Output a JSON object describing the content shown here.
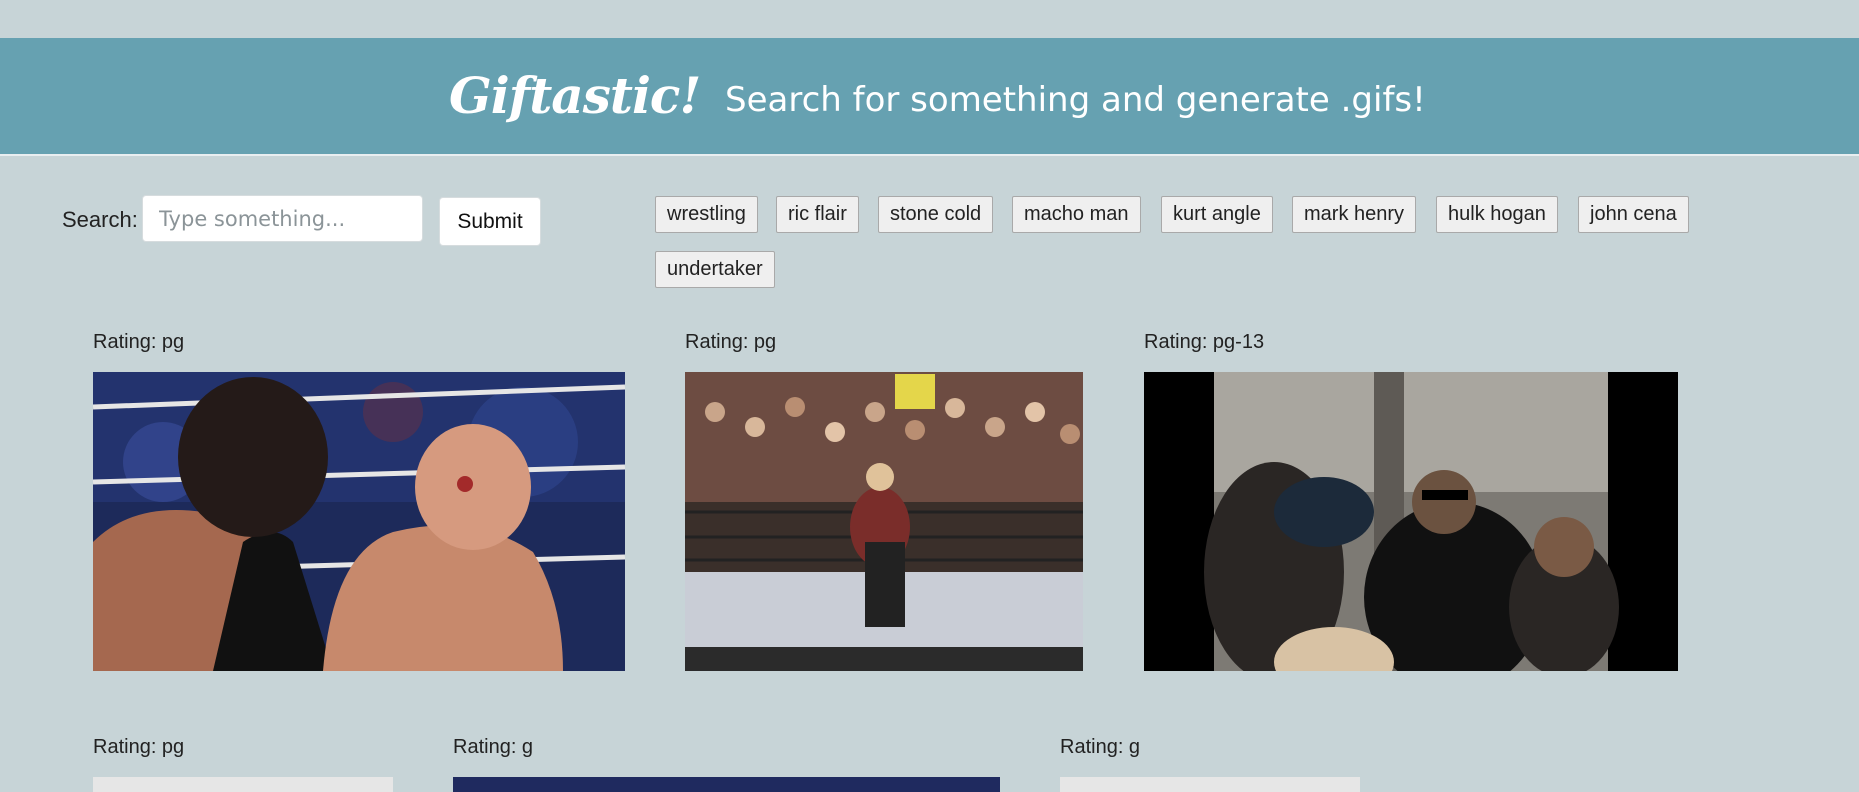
{
  "header": {
    "brand": "Giftastic!",
    "tagline": "Search for something and generate .gifs!"
  },
  "search": {
    "label": "Search:",
    "placeholder": "Type something...",
    "value": "",
    "submit_label": "Submit"
  },
  "topics": [
    "wrestling",
    "ric flair",
    "stone cold",
    "macho man",
    "kurt angle",
    "mark henry",
    "hulk hogan",
    "john cena",
    "undertaker"
  ],
  "results": [
    {
      "rating": "Rating: pg"
    },
    {
      "rating": "Rating: pg"
    },
    {
      "rating": "Rating: pg-13"
    },
    {
      "rating": "Rating: pg"
    },
    {
      "rating": "Rating: g"
    },
    {
      "rating": "Rating: g"
    }
  ],
  "colors": {
    "page_bg": "#c7d4d7",
    "header_bg": "#66a1b1"
  }
}
